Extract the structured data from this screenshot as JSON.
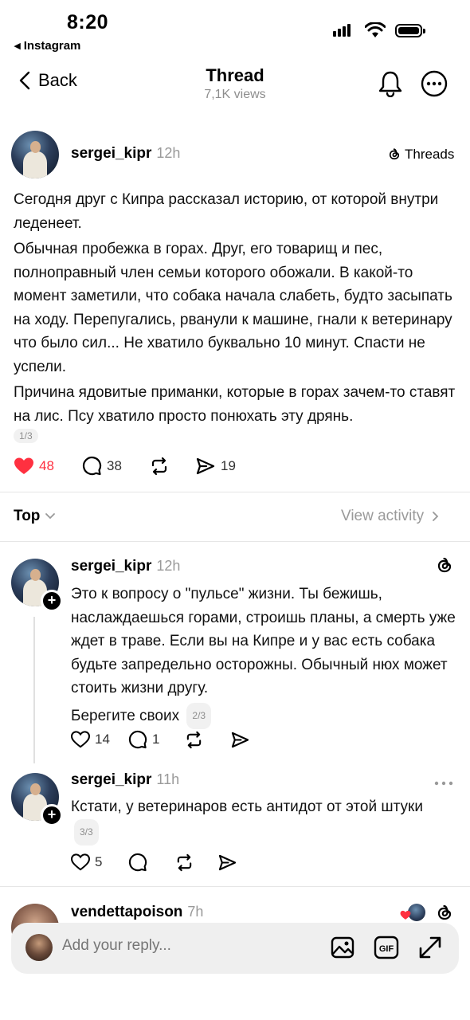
{
  "status_bar": {
    "time": "8:20",
    "back_app": "◂ Instagram"
  },
  "header": {
    "back_label": "Back",
    "title": "Thread",
    "views": "7,1K views"
  },
  "post": {
    "username": "sergei_kipr",
    "time": "12h",
    "source": "Threads",
    "paragraphs": [
      "Сегодня друг с Кипра рассказал историю, от которой внутри леденеет.",
      "Обычная пробежка в горах. Друг, его товарищ и пес, полноправный член семьи которого обожали. В какой-то момент заметили, что собака начала слабеть, будто засыпать на ходу. Перепугались, рванули к машине, гнали к ветеринару что было сил... Не хватило буквально 10 минут. Спасти не успели.",
      "Причина ядовитые приманки, которые в горах зачем-то ставят на лис. Псу хватило просто понюхать эту дрянь."
    ],
    "page": "1/3",
    "likes": "48",
    "comments": "38",
    "shares": "19",
    "liked": true
  },
  "sort": {
    "label": "Top",
    "view_activity": "View activity"
  },
  "replies": [
    {
      "username": "sergei_kipr",
      "time": "12h",
      "text": "Это к вопросу о \"пульсе\" жизни. Ты бежишь, наслаждаешься горами, строишь планы, а смерть уже ждет в траве. Если вы на Кипре и у вас есть собака будьте запредельно осторожны. Обычный нюх может стоить жизни другу.",
      "text2": "Берегите своих",
      "page": "2/3",
      "likes": "14",
      "comments": "1"
    },
    {
      "username": "sergei_kipr",
      "time": "11h",
      "text": "Кстати, у ветеринаров есть антидот от этой штуки",
      "page": "3/3",
      "likes": "5"
    },
    {
      "username": "vendettapoison",
      "time": "7h"
    }
  ],
  "reply_bar": {
    "placeholder": "Add your reply..."
  },
  "colors": {
    "like_red": "#ff3040",
    "muted": "#8e8e8e"
  }
}
